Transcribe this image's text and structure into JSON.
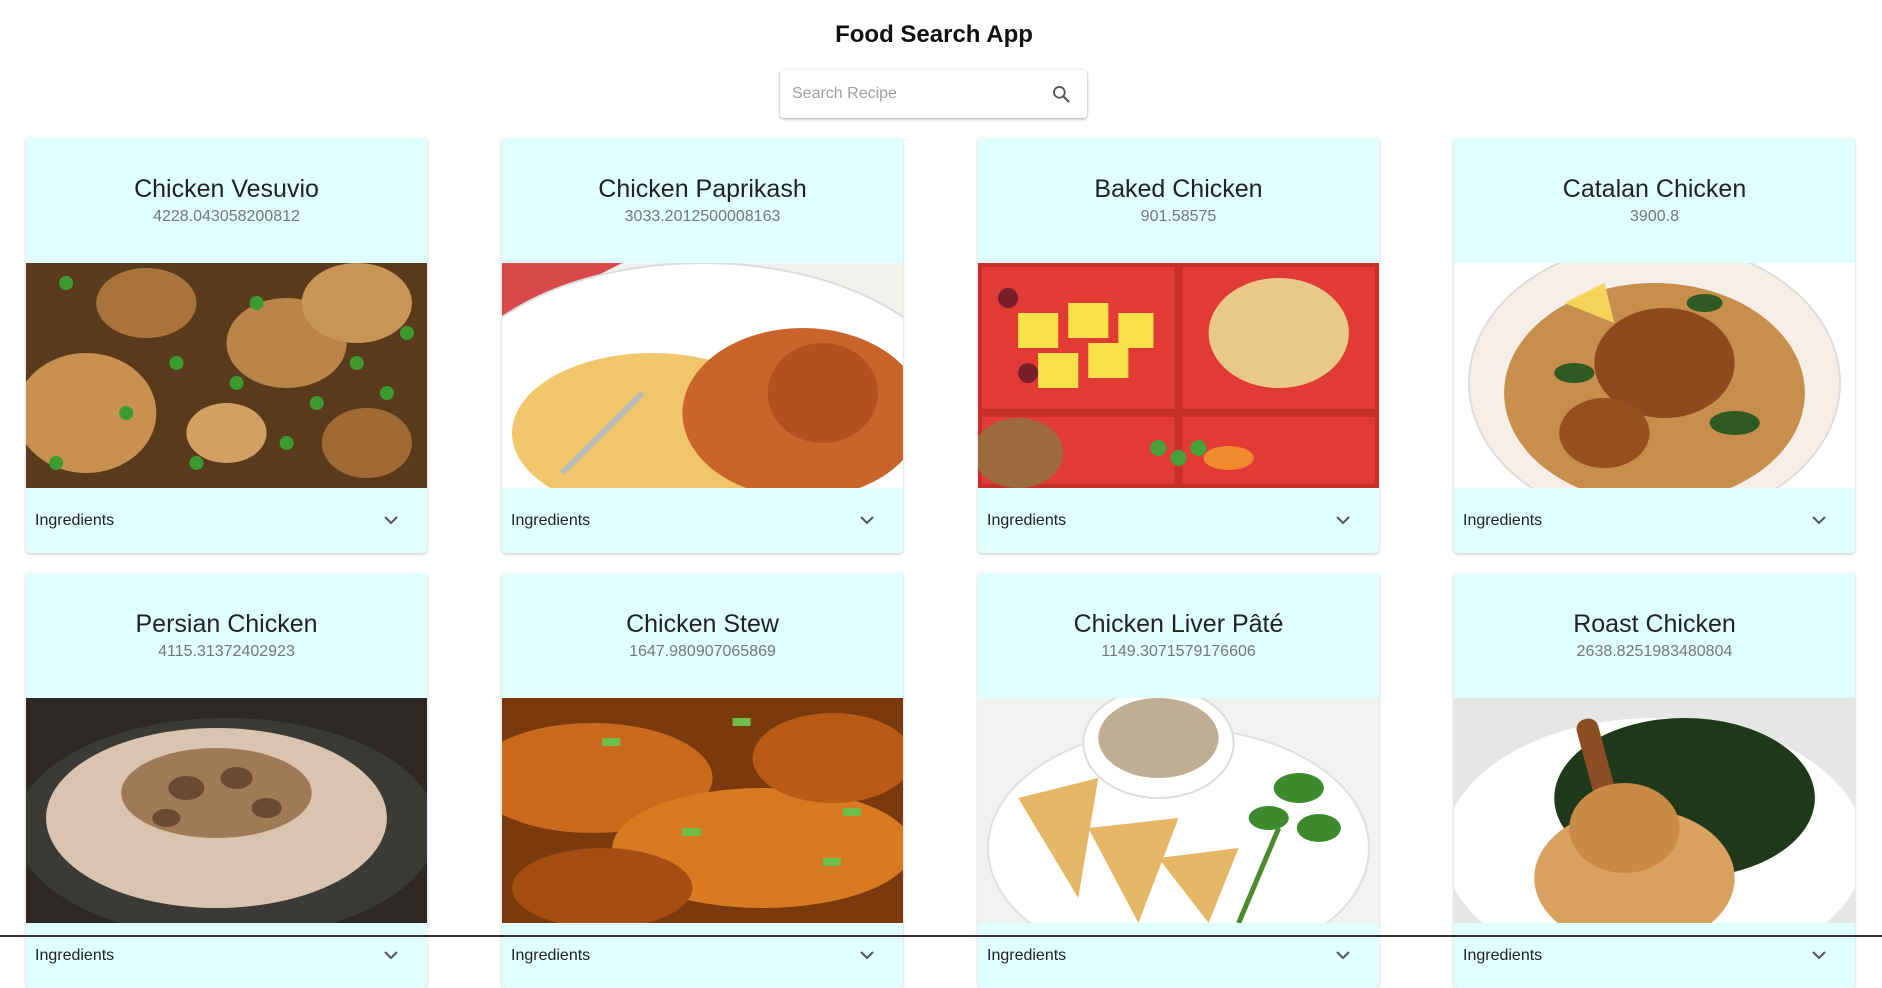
{
  "app": {
    "title": "Food Search App"
  },
  "search": {
    "placeholder": "Search Recipe",
    "value": ""
  },
  "card_footer_label": "Ingredients",
  "recipes": [
    {
      "title": "Chicken Vesuvio",
      "calories": "4228.043058200812"
    },
    {
      "title": "Chicken Paprikash",
      "calories": "3033.2012500008163"
    },
    {
      "title": "Baked Chicken",
      "calories": "901.58575"
    },
    {
      "title": "Catalan Chicken",
      "calories": "3900.8"
    },
    {
      "title": "Persian Chicken",
      "calories": "4115.31372402923"
    },
    {
      "title": "Chicken Stew",
      "calories": "1647.980907065869"
    },
    {
      "title": "Chicken Liver Pâté",
      "calories": "1149.3071579176606"
    },
    {
      "title": "Roast Chicken",
      "calories": "2638.8251983480804"
    }
  ],
  "colors": {
    "card_background": "#e0ffff",
    "page_background": "#ffffff"
  }
}
